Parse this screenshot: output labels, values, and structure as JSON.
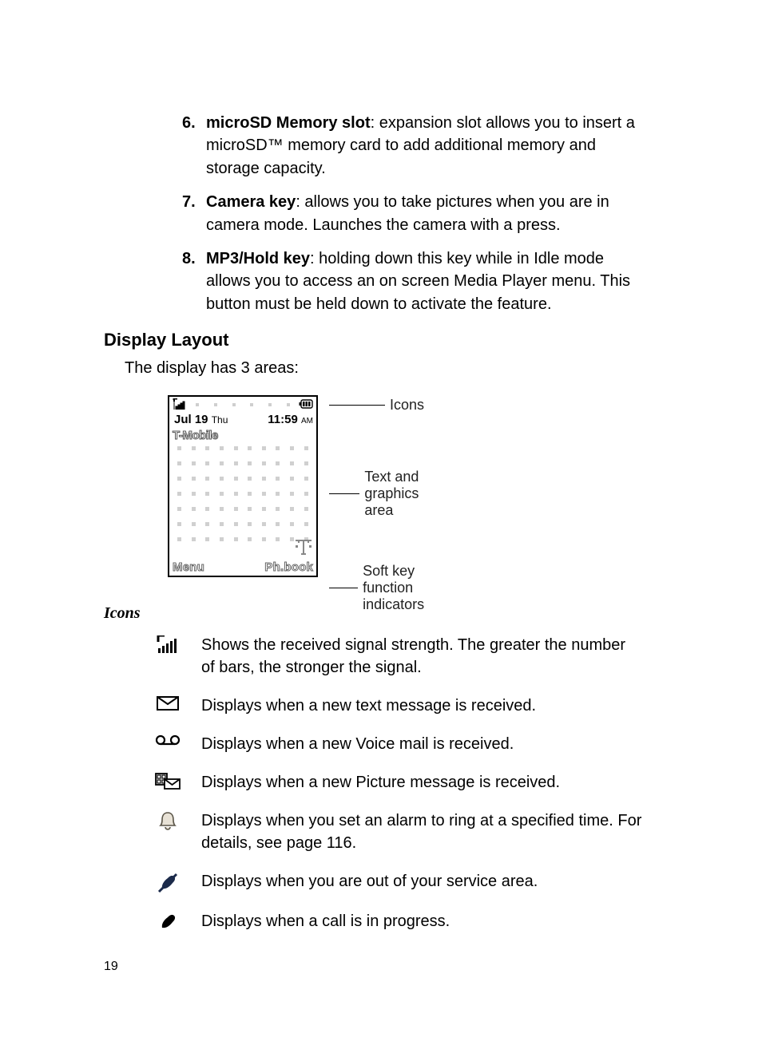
{
  "list": {
    "items": [
      {
        "num": "6.",
        "lead": "microSD Memory slot",
        "rest": ": expansion slot allows you to insert a microSD™ memory card to add additional memory and storage capacity."
      },
      {
        "num": "7.",
        "lead": "Camera key",
        "rest": ": allows you to take pictures when you are in camera mode. Launches the camera with a press."
      },
      {
        "num": "8.",
        "lead": "MP3/Hold key",
        "rest": ": holding down this key while in Idle mode allows you to access an on screen Media Player menu. This button must be held down to activate the feature."
      }
    ]
  },
  "headings": {
    "display_layout": "Display Layout",
    "icons": "Icons"
  },
  "intro_text": "The display has 3 areas:",
  "figure": {
    "date": "Jul 19",
    "day": "Thu",
    "time": "11:59",
    "ampm": "AM",
    "carrier": "T-Mobile",
    "soft_left": "Menu",
    "soft_right": "Ph.book",
    "labels": {
      "icons": "Icons",
      "text_area": "Text and graphics area",
      "softkeys": "Soft key function indicators"
    }
  },
  "icon_rows": [
    {
      "id": "signal",
      "text": "Shows the received signal strength. The greater the number of bars, the stronger the signal."
    },
    {
      "id": "text-msg",
      "text": "Displays when a new text message is received."
    },
    {
      "id": "voicemail",
      "text": "Displays when a new Voice mail is received."
    },
    {
      "id": "picture-msg",
      "text": "Displays when a new Picture message is received."
    },
    {
      "id": "alarm",
      "text": "Displays when you set an alarm to ring at a specified time. For details, see page 116."
    },
    {
      "id": "no-service",
      "text": "Displays when you are out of your service area."
    },
    {
      "id": "in-call",
      "text": "Displays when a call is in progress."
    }
  ],
  "page_number": "19"
}
